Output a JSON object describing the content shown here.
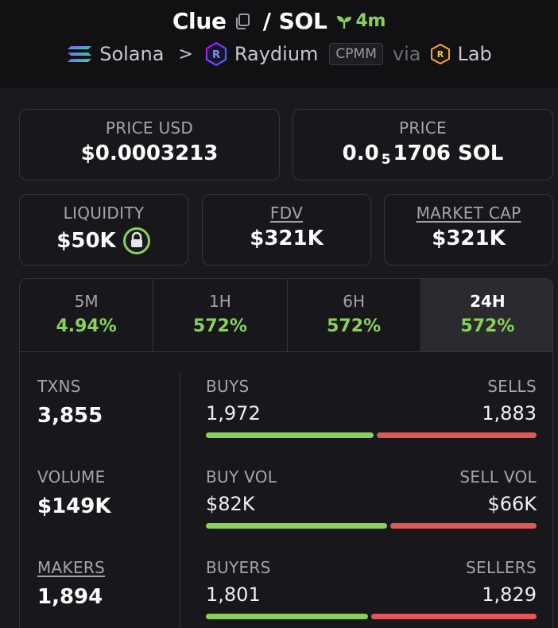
{
  "header": {
    "token": "Clue",
    "separator": "/",
    "quote": "SOL",
    "age": "4m",
    "chain": "Solana",
    "dex": "Raydium",
    "pool_type": "CPMM",
    "via": "via",
    "launchpad": "Lab"
  },
  "price_usd": {
    "label": "PRICE USD",
    "value": "$0.0003213"
  },
  "price": {
    "label": "PRICE",
    "prefix": "0.0",
    "zeros": "5",
    "suffix": "1706 SOL"
  },
  "liquidity": {
    "label": "LIQUIDITY",
    "value": "$50K"
  },
  "fdv": {
    "label": "FDV",
    "value": "$321K"
  },
  "market_cap": {
    "label": "MARKET CAP",
    "value": "$321K"
  },
  "tabs": [
    {
      "label": "5M",
      "value": "4.94%"
    },
    {
      "label": "1H",
      "value": "572%"
    },
    {
      "label": "6H",
      "value": "572%"
    },
    {
      "label": "24H",
      "value": "572%"
    }
  ],
  "active_tab": "24H",
  "stats": {
    "txns": {
      "label": "TXNS",
      "value": "3,855"
    },
    "volume": {
      "label": "VOLUME",
      "value": "$149K"
    },
    "makers": {
      "label": "MAKERS",
      "value": "1,894"
    }
  },
  "splits": {
    "txns": {
      "left_label": "BUYS",
      "right_label": "SELLS",
      "left_value": "1,972",
      "right_value": "1,883",
      "buy_share": 0.512
    },
    "volume": {
      "left_label": "BUY VOL",
      "right_label": "SELL VOL",
      "left_value": "$82K",
      "right_value": "$66K",
      "buy_share": 0.554
    },
    "makers": {
      "left_label": "BUYERS",
      "right_label": "SELLERS",
      "left_value": "1,801",
      "right_value": "1,829",
      "buy_share": 0.496
    }
  },
  "colors": {
    "positive": "#8ad15a",
    "negative": "#e25656",
    "background": "#1a1a1e"
  }
}
